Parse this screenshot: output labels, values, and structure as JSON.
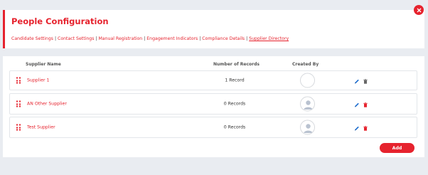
{
  "header": {
    "title": "People Configuration",
    "nav": [
      {
        "label": "Candidate Settings"
      },
      {
        "label": "Contact Settings"
      },
      {
        "label": "Manual Registration"
      },
      {
        "label": "Engagement Indicators"
      },
      {
        "label": "Compliance Details"
      },
      {
        "label": "Supplier Directory",
        "active": true
      }
    ],
    "separator": " | "
  },
  "table": {
    "columns": {
      "name": "Supplier Name",
      "records": "Number of Records",
      "created_by": "Created By"
    },
    "rows": [
      {
        "name": "Supplier 1",
        "records": "1 Record",
        "avatar": "empty"
      },
      {
        "name": "AN Other Supplier",
        "records": "0 Records",
        "avatar": "person"
      },
      {
        "name": "Test Supplier",
        "records": "0 Records",
        "avatar": "person"
      }
    ]
  },
  "actions": {
    "add_label": "Add"
  },
  "icons": {
    "close": "close-icon",
    "drag": "drag-handle-icon",
    "edit": "pencil-icon",
    "delete": "trash-icon",
    "avatar": "user-avatar-icon"
  },
  "colors": {
    "accent": "#e6232e",
    "edit_icon": "#1e6fd1",
    "background": "#e9ecf1"
  }
}
